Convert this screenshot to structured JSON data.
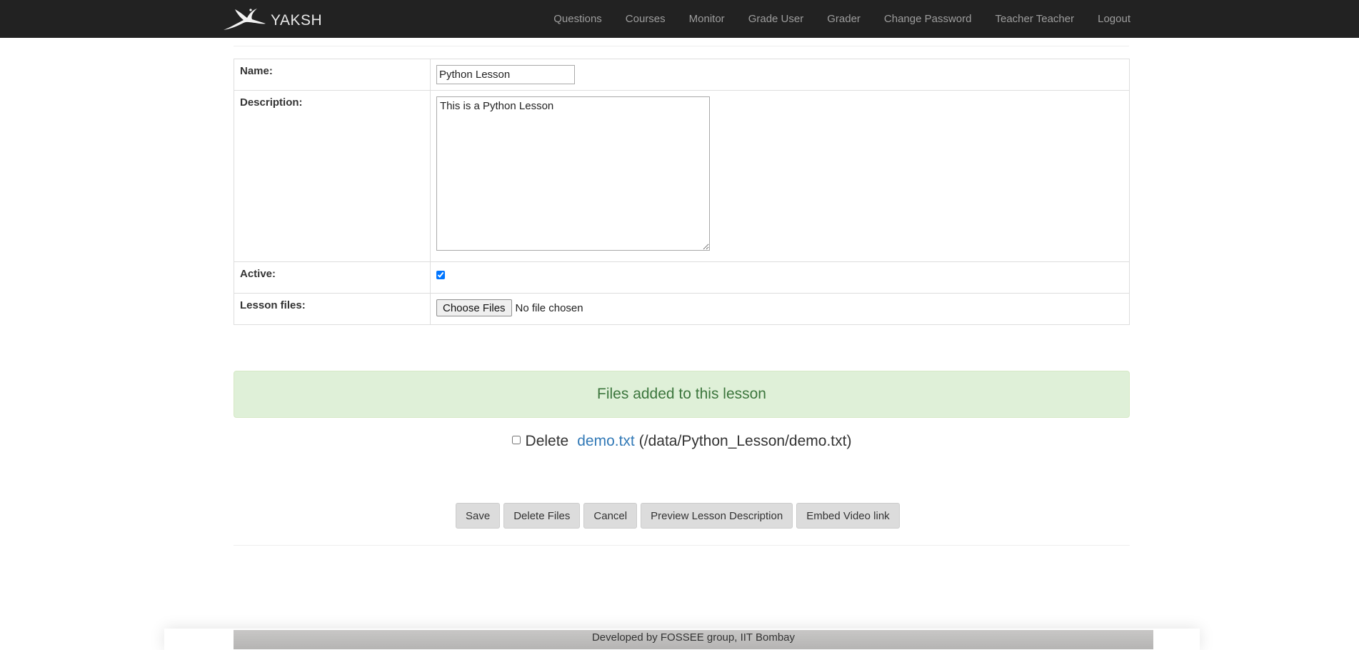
{
  "navbar": {
    "brand": "YAKSH",
    "links": [
      {
        "label": "Questions"
      },
      {
        "label": "Courses"
      },
      {
        "label": "Monitor"
      },
      {
        "label": "Grade User"
      },
      {
        "label": "Grader"
      },
      {
        "label": "Change Password"
      },
      {
        "label": "Teacher Teacher"
      },
      {
        "label": "Logout"
      }
    ]
  },
  "form": {
    "name_label": "Name:",
    "name_value": "Python Lesson",
    "description_label": "Description:",
    "description_value": "This is a Python Lesson",
    "active_label": "Active:",
    "active_checked": true,
    "files_label": "Lesson files:",
    "choose_files_label": "Choose Files",
    "no_file_text": "No file chosen"
  },
  "files_section": {
    "alert_text": "Files added to this lesson",
    "delete_label": "Delete",
    "file_name": "demo.txt",
    "file_path": "(/data/Python_Lesson/demo.txt)"
  },
  "actions": {
    "save": "Save",
    "delete_files": "Delete Files",
    "cancel": "Cancel",
    "preview": "Preview Lesson Description",
    "embed": "Embed Video link"
  },
  "footer": {
    "text": "Developed by FOSSEE group, IIT Bombay"
  },
  "colors": {
    "navbar_bg": "#222222",
    "nav_link": "#9d9d9d",
    "alert_bg": "#dff0d8",
    "alert_text": "#3c763d",
    "link": "#337ab7"
  }
}
